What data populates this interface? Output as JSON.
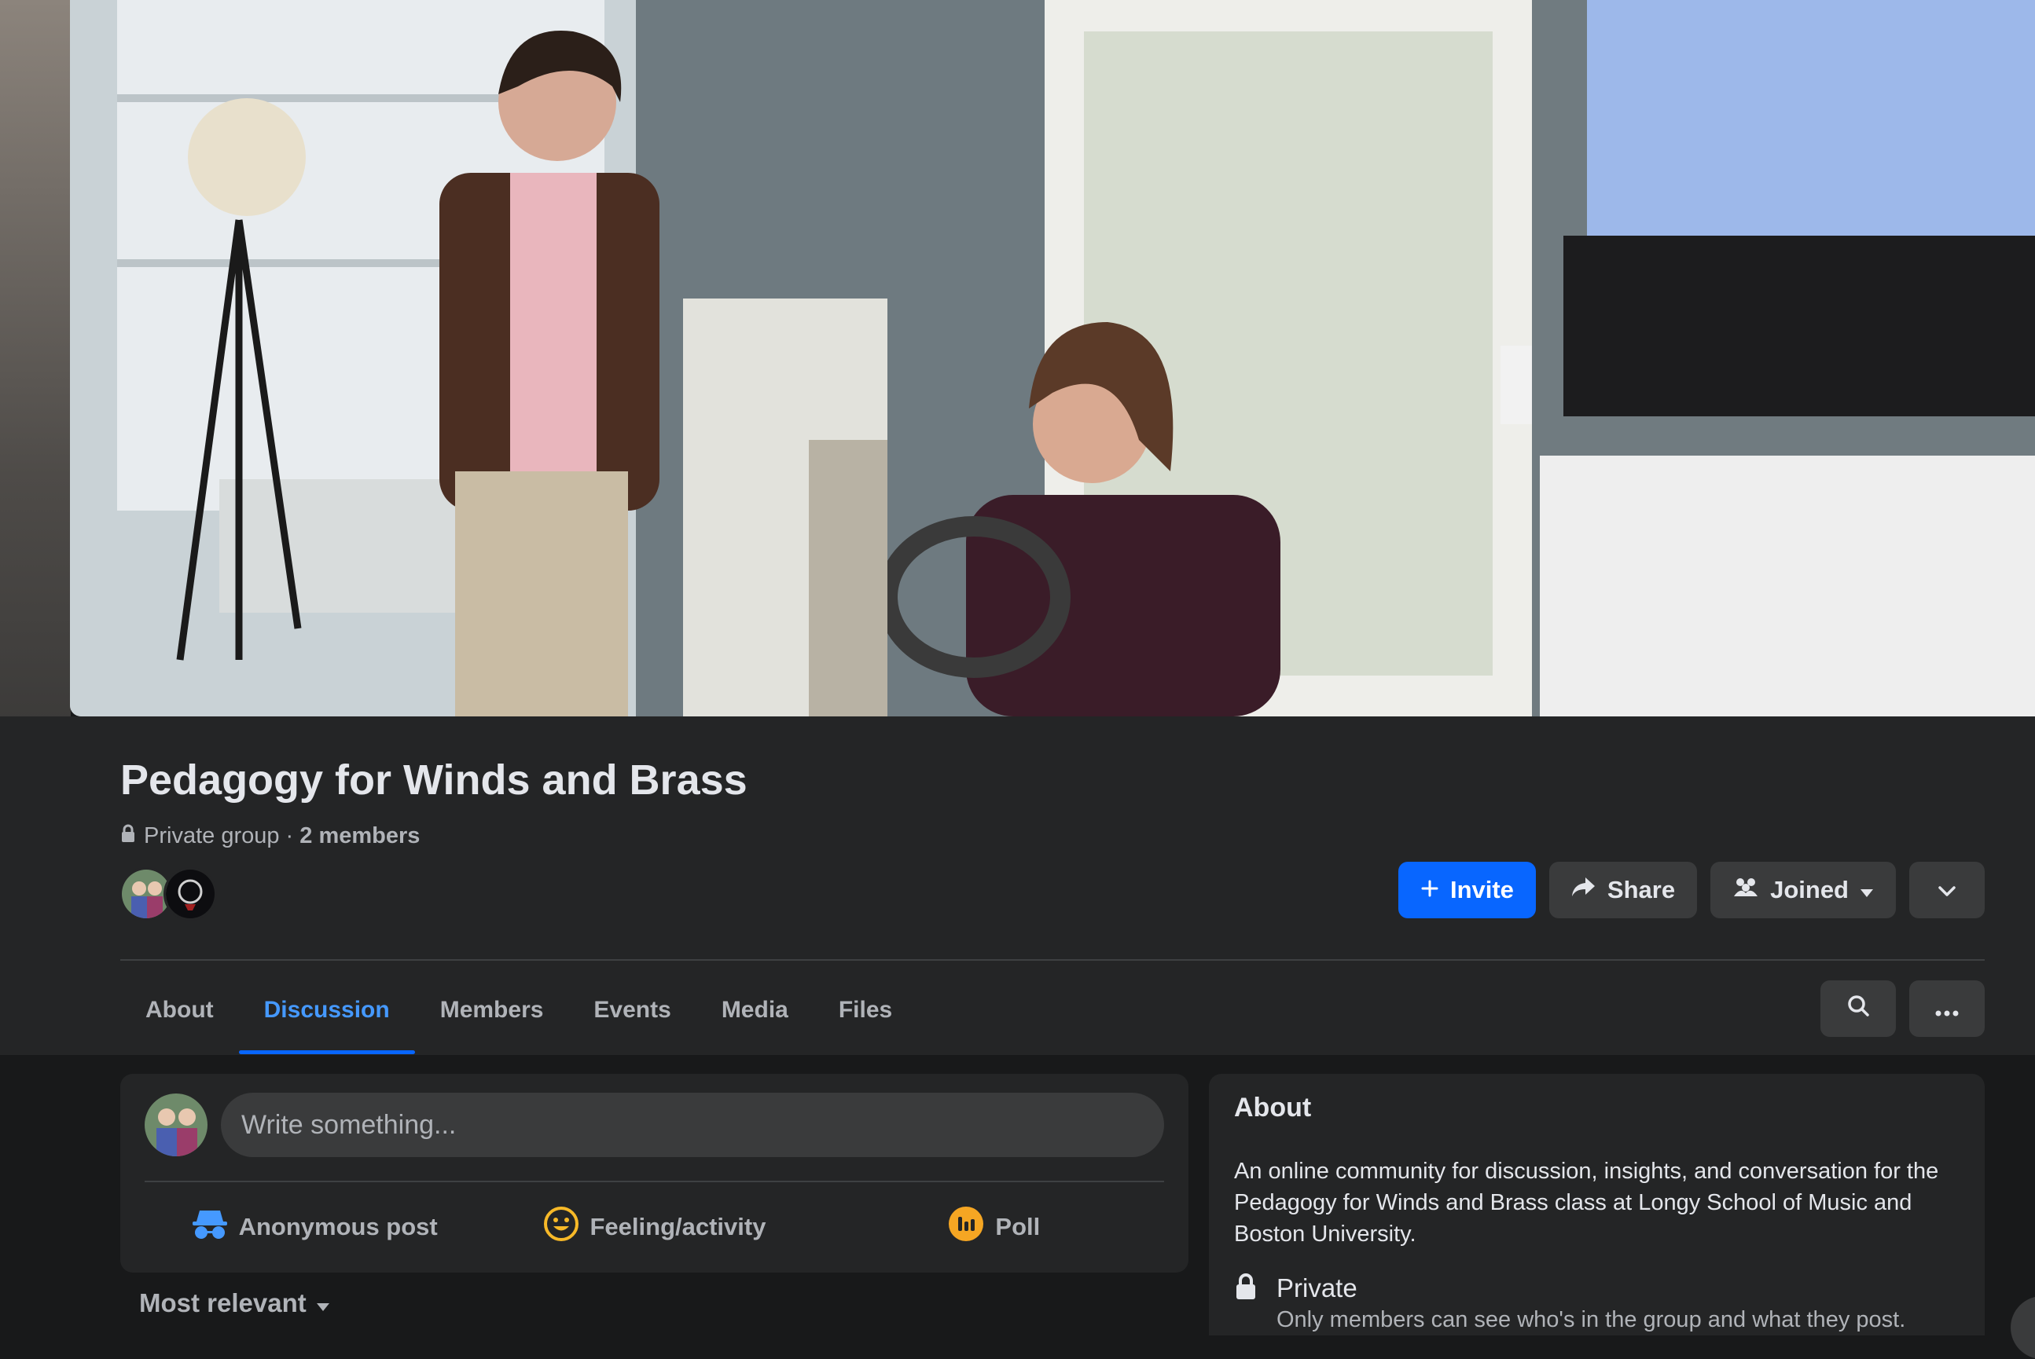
{
  "group": {
    "title": "Pedagogy for Winds and Brass",
    "privacy": "Private group",
    "separator": " · ",
    "members": "2 members"
  },
  "actions": {
    "invite": "Invite",
    "share": "Share",
    "joined": "Joined"
  },
  "tabs": [
    {
      "label": "About"
    },
    {
      "label": "Discussion",
      "active": true
    },
    {
      "label": "Members"
    },
    {
      "label": "Events"
    },
    {
      "label": "Media"
    },
    {
      "label": "Files"
    }
  ],
  "composer": {
    "placeholder": "Write something...",
    "options": [
      "Anonymous post",
      "Feeling/activity",
      "Poll"
    ]
  },
  "feed": {
    "sort_label": "Most relevant"
  },
  "about": {
    "heading": "About",
    "description": "An online community for discussion, insights, and conversation for the Pedagogy for Winds and Brass class at Longy School of Music and Boston University.",
    "privacy_title": "Private",
    "privacy_desc": "Only members can see who's in the group and what they post."
  },
  "colors": {
    "accent": "#0866ff",
    "active_tab": "#4599ff",
    "card": "#242526",
    "page": "#18191a"
  },
  "icons": [
    "lock-icon",
    "plus-icon",
    "share-arrow-icon",
    "people-icon",
    "caret-down-icon",
    "chevron-down-icon",
    "search-icon",
    "more-icon",
    "incognito-icon",
    "smiley-icon",
    "poll-icon"
  ]
}
